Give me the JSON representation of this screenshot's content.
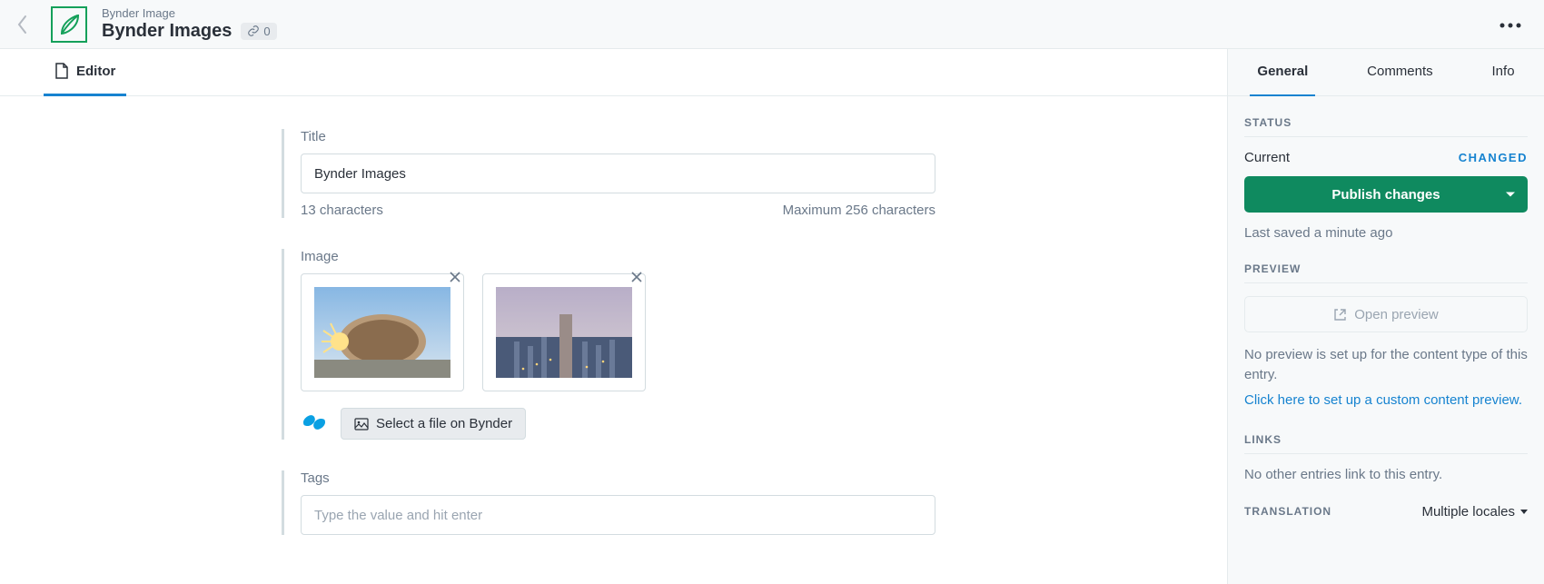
{
  "header": {
    "breadcrumb": "Bynder Image",
    "title": "Bynder Images",
    "badge_count": "0"
  },
  "main_tabs": {
    "editor": "Editor"
  },
  "fields": {
    "title": {
      "label": "Title",
      "value": "Bynder Images",
      "char_count": "13 characters",
      "max": "Maximum 256 characters"
    },
    "image": {
      "label": "Image",
      "select_button": "Select a file on Bynder"
    },
    "tags": {
      "label": "Tags",
      "placeholder": "Type the value and hit enter"
    }
  },
  "side_tabs": {
    "general": "General",
    "comments": "Comments",
    "info": "Info"
  },
  "status": {
    "heading": "STATUS",
    "current_label": "Current",
    "changed_label": "CHANGED",
    "publish_label": "Publish changes",
    "last_saved": "Last saved a minute ago"
  },
  "preview": {
    "heading": "PREVIEW",
    "button_label": "Open preview",
    "note": "No preview is set up for the content type of this entry.",
    "link": "Click here to set up a custom content preview."
  },
  "links": {
    "heading": "LINKS",
    "note": "No other entries link to this entry."
  },
  "translation": {
    "heading": "TRANSLATION",
    "select_label": "Multiple locales"
  }
}
